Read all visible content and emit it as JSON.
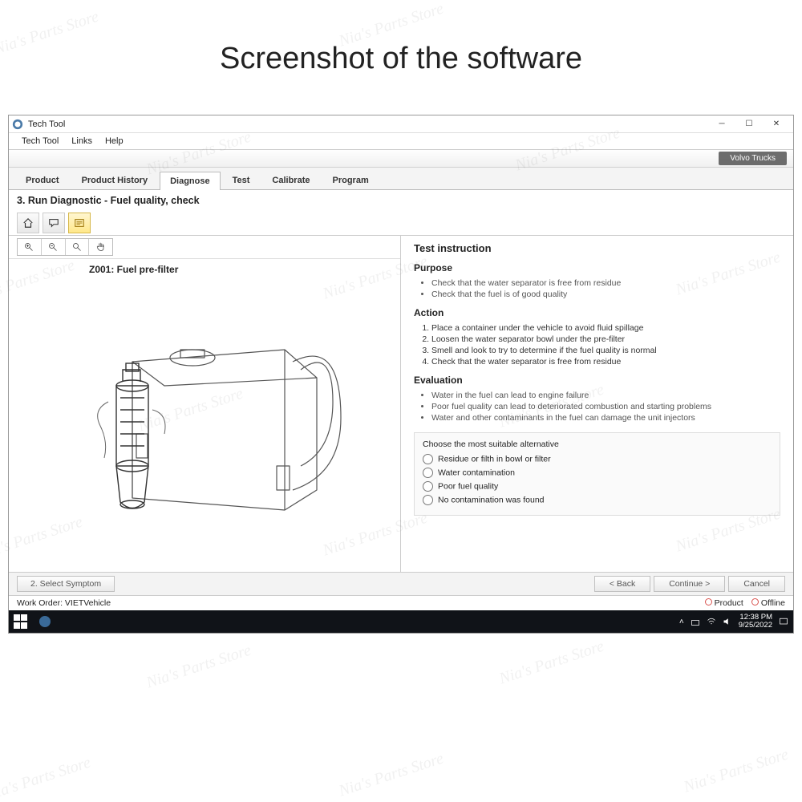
{
  "outer_title": "Screenshot of the software",
  "window": {
    "title": "Tech Tool"
  },
  "menu": {
    "items": [
      "Tech Tool",
      "Links",
      "Help"
    ]
  },
  "brand_button": "Volvo Trucks",
  "tabs": [
    "Product",
    "Product History",
    "Diagnose",
    "Test",
    "Calibrate",
    "Program"
  ],
  "active_tab_index": 2,
  "page_heading": "3. Run Diagnostic - Fuel quality, check",
  "diagram_title": "Z001: Fuel pre-filter",
  "instruction": {
    "heading": "Test instruction",
    "purpose_heading": "Purpose",
    "purpose": [
      "Check that the water separator is free from residue",
      "Check that the fuel is of good quality"
    ],
    "action_heading": "Action",
    "action": [
      "Place a container under the vehicle to avoid fluid spillage",
      "Loosen the water separator bowl under the pre-filter",
      "Smell and look to try to determine if the fuel quality is normal",
      "Check that the water separator is free from residue"
    ],
    "evaluation_heading": "Evaluation",
    "evaluation": [
      "Water in the fuel can lead to engine failure",
      "Poor fuel quality can lead to deteriorated combustion and starting problems",
      "Water and other contaminants in the fuel can damage the unit injectors"
    ],
    "choose_prompt": "Choose the most suitable alternative",
    "choose_options": [
      "Residue or filth in bowl or filter",
      "Water contamination",
      "Poor fuel quality",
      "No contamination was found"
    ]
  },
  "breadcrumb": "2. Select Symptom",
  "nav": {
    "back": "< Back",
    "continue": "Continue >",
    "cancel": "Cancel"
  },
  "status": {
    "work_order": "Work Order: VIETVehicle",
    "product": "Product",
    "offline": "Offline"
  },
  "taskbar": {
    "time": "12:38 PM",
    "date": "9/25/2022"
  },
  "watermark": "Nia's Parts Store"
}
